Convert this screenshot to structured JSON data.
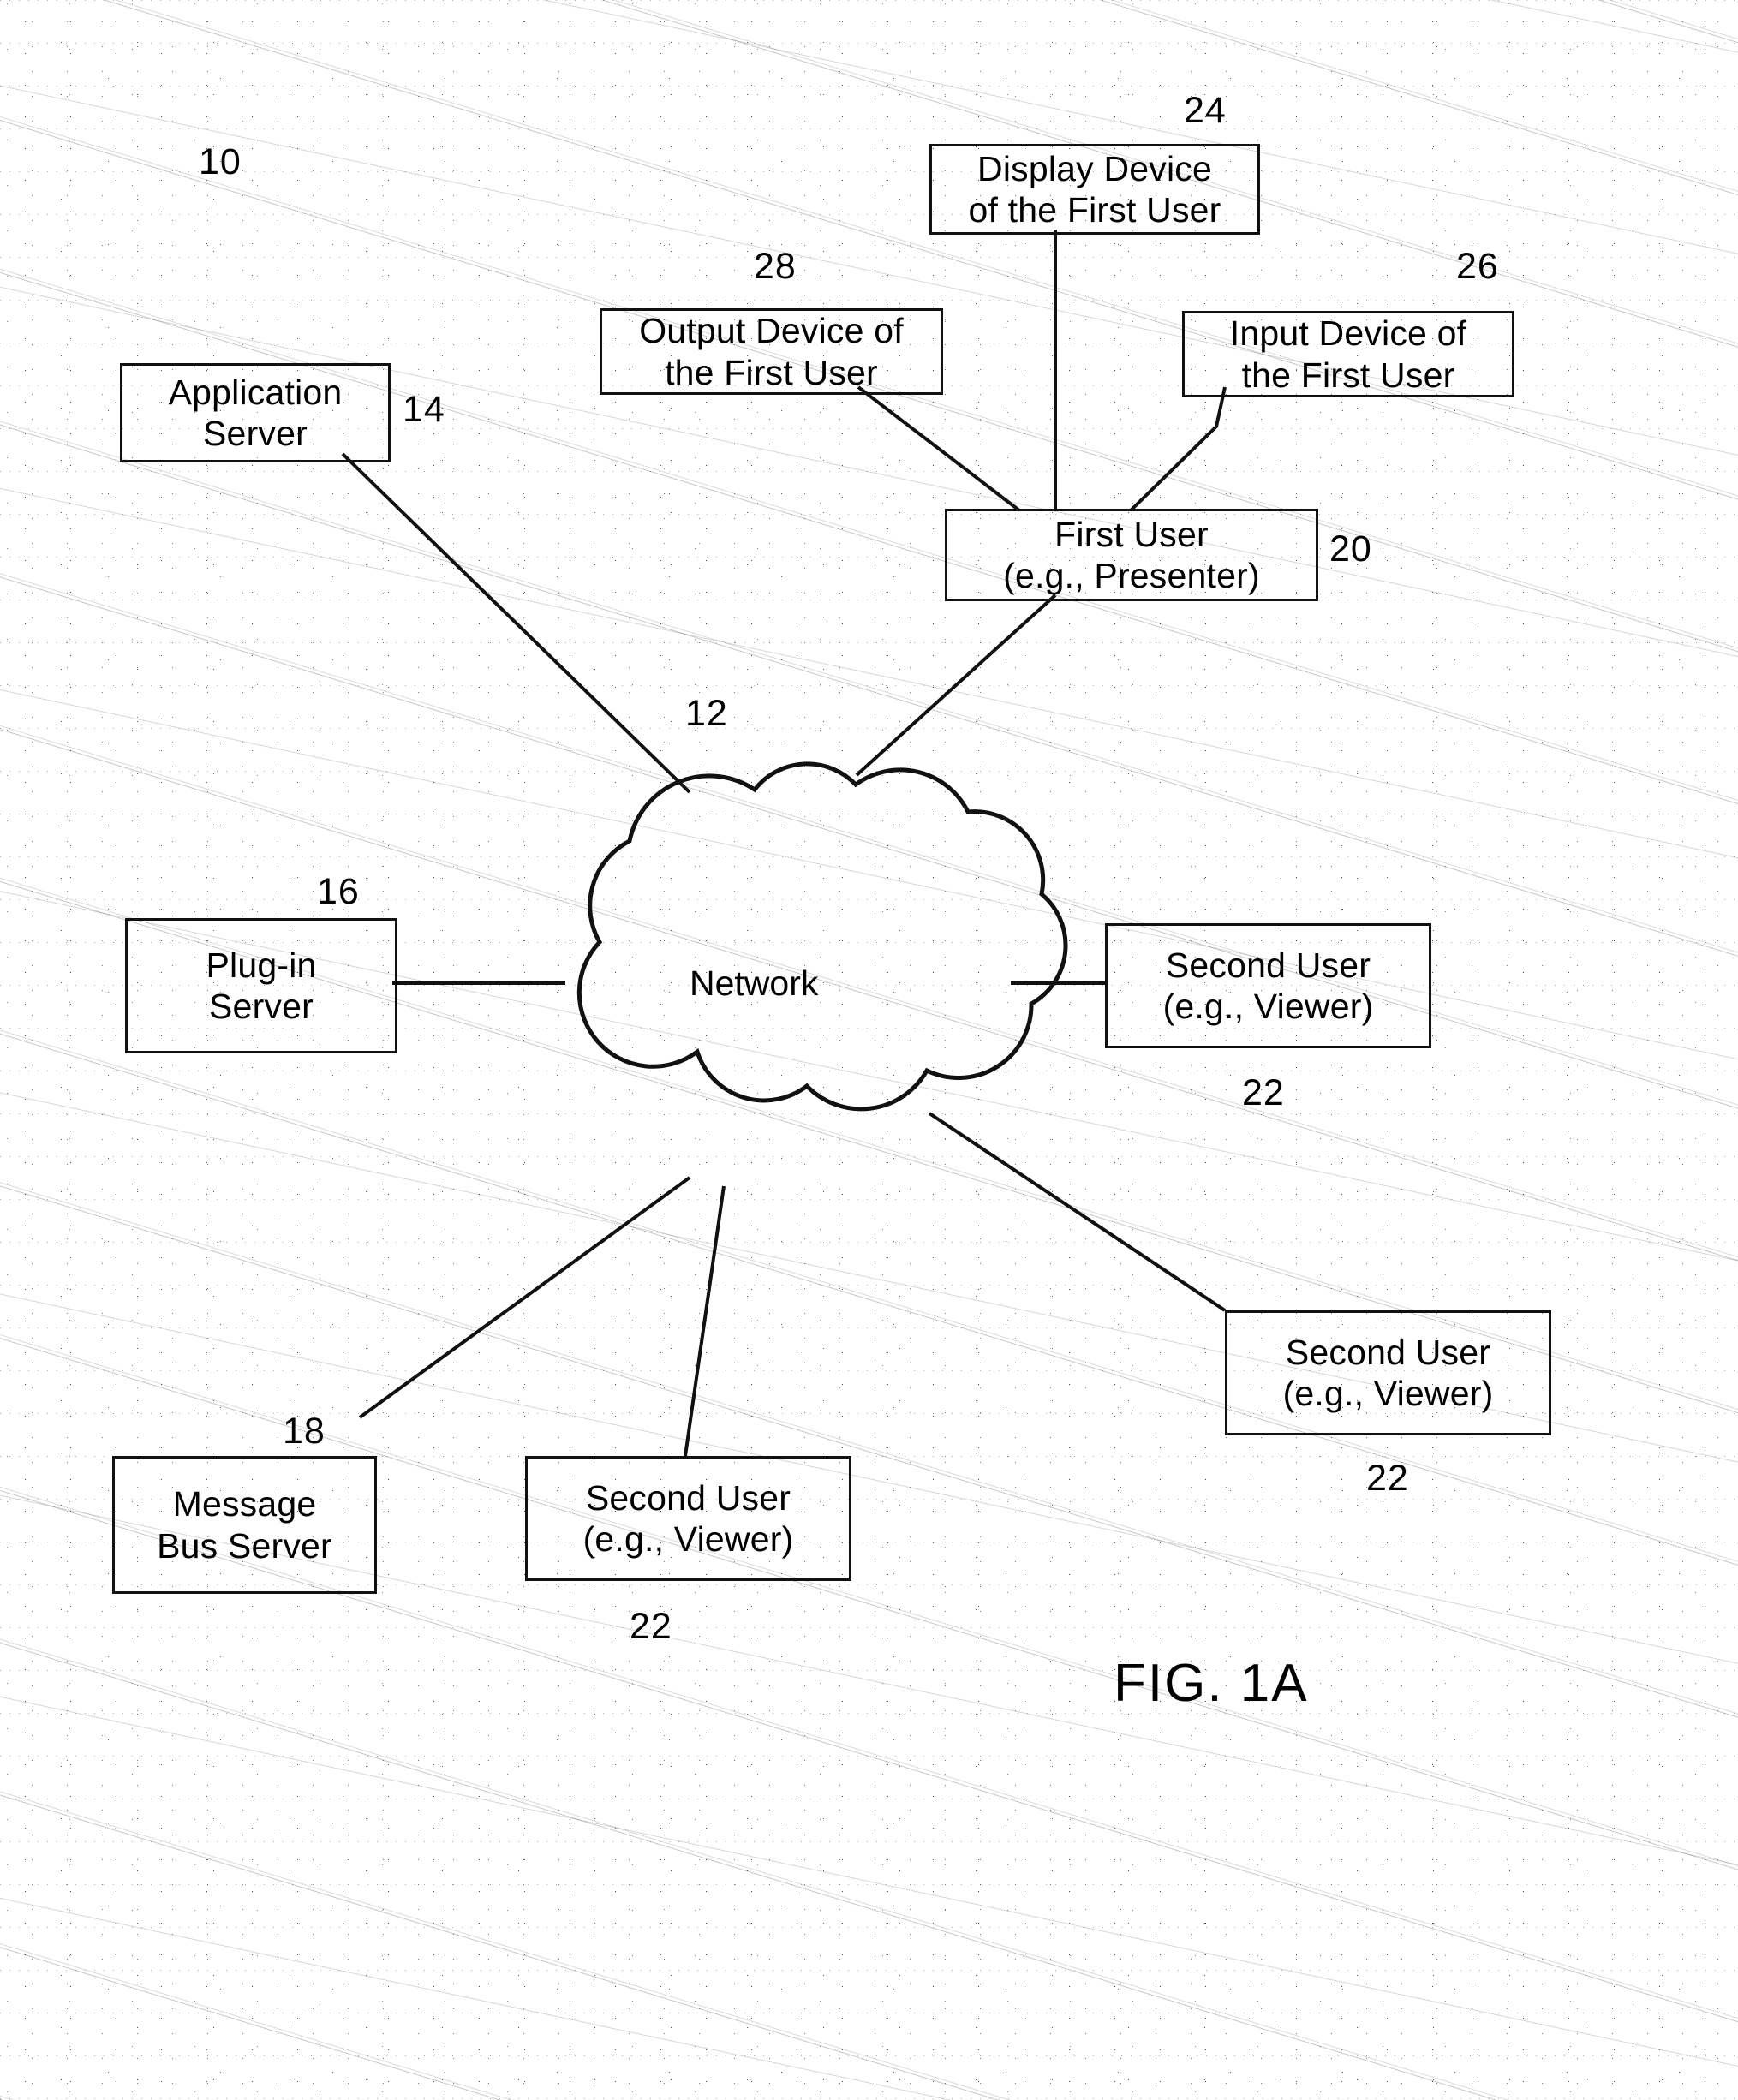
{
  "figure": {
    "caption": "FIG. 1A",
    "system_ref": "10"
  },
  "nodes": [
    {
      "id": "display_device",
      "label_line1": "Display Device",
      "label_line2": "of the First User",
      "ref": "24"
    },
    {
      "id": "output_device",
      "label_line1": "Output Device of",
      "label_line2": "the First User",
      "ref": "28"
    },
    {
      "id": "input_device",
      "label_line1": "Input Device of",
      "label_line2": "the First User",
      "ref": "26"
    },
    {
      "id": "application_server",
      "label_line1": "Application",
      "label_line2": "Server",
      "ref": "14"
    },
    {
      "id": "first_user",
      "label_line1": "First User",
      "label_line2": "(e.g., Presenter)",
      "ref": "20"
    },
    {
      "id": "plugin_server",
      "label_line1": "Plug-in",
      "label_line2": "Server",
      "ref": "16"
    },
    {
      "id": "message_bus_server",
      "label_line1": "Message",
      "label_line2": "Bus Server",
      "ref": "18"
    },
    {
      "id": "second_user_right",
      "label_line1": "Second User",
      "label_line2": "(e.g., Viewer)",
      "ref": "22"
    },
    {
      "id": "second_user_lower_right",
      "label_line1": "Second User",
      "label_line2": "(e.g., Viewer)",
      "ref": "22"
    },
    {
      "id": "second_user_bottom",
      "label_line1": "Second User",
      "label_line2": "(e.g., Viewer)",
      "ref": "22"
    }
  ],
  "network": {
    "label": "Network",
    "ref": "12"
  }
}
